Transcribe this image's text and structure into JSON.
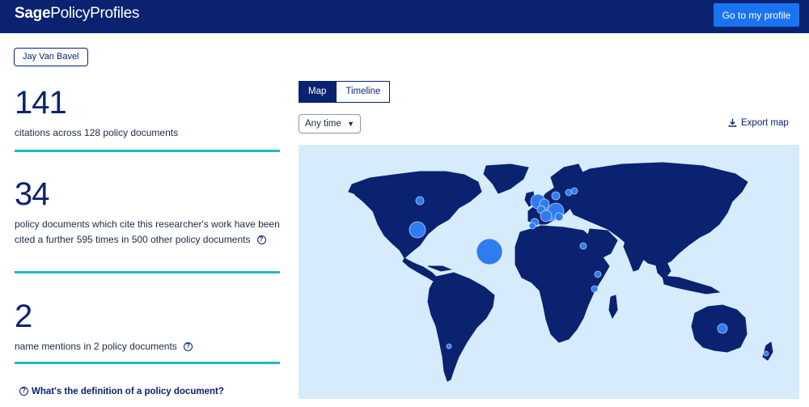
{
  "header": {
    "brand_part1": "Sage",
    "brand_part2": "Policy",
    "brand_part3": "Profiles",
    "profile_button": "Go to my profile"
  },
  "researcher_chip": "Jay Van Bavel",
  "stats": [
    {
      "value": "141",
      "description": "citations across 128 policy documents"
    },
    {
      "value": "34",
      "description": "policy documents which cite this researcher's work have been cited a further 595 times in 500 other policy documents"
    },
    {
      "value": "2",
      "description": "name mentions in 2 policy documents"
    }
  ],
  "definition_link": "What's the definition of a policy document?",
  "view_tabs": [
    {
      "label": "Map",
      "active": true
    },
    {
      "label": "Timeline",
      "active": false
    }
  ],
  "time_filter": {
    "selected": "Any time"
  },
  "export_label": "Export map",
  "colors": {
    "header_bg": "#0a2270",
    "accent_button": "#1a73f0",
    "rule": "#21b9c4",
    "ocean": "#d6ebfb",
    "land": "#0a2270",
    "bubble": "#2f7cf0"
  },
  "icons": {
    "help": "question-circle-icon",
    "export": "download-icon",
    "dropdown": "chevron-down-icon"
  }
}
